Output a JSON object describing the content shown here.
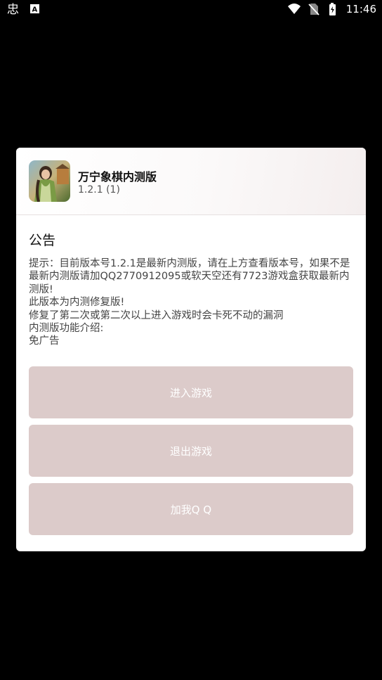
{
  "status_bar": {
    "time": "11:46",
    "left_icons": [
      "bug-icon",
      "font-notification-icon"
    ],
    "right_icons": [
      "wifi-icon",
      "no-sim-icon",
      "battery-charging-icon"
    ]
  },
  "dialog": {
    "app_name": "万宁象棋内测版",
    "app_version": "1.2.1 (1)",
    "notice_title": "公告",
    "notice_text": "提示：目前版本号1.2.1是最新内测版，请在上方查看版本号，如果不是最新内测版请加QQ2770912095或软天空还有7723游戏盒获取最新内测版!\n此版本为内测修复版!\n修复了第二次或第二次以上进入游戏时会卡死不动的漏洞\n内测版功能介绍:\n免广告",
    "buttons": {
      "enter": "进入游戏",
      "exit": "退出游戏",
      "qq": "加我Q Q"
    }
  },
  "colors": {
    "button_bg": "#dccbca",
    "button_text": "#ffffff",
    "backdrop": "#000000"
  }
}
